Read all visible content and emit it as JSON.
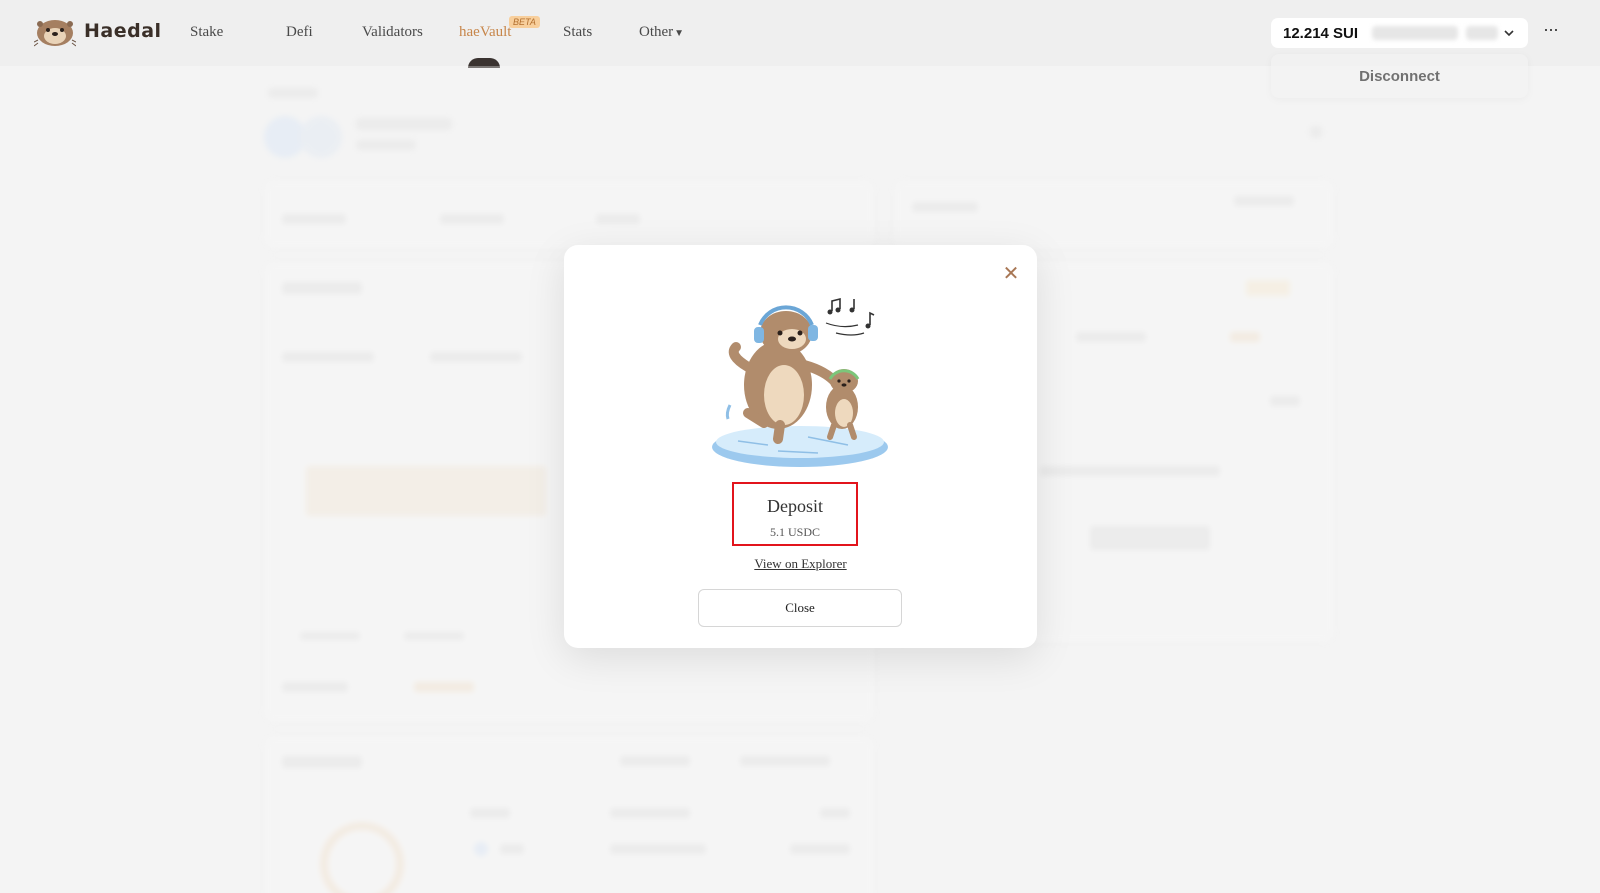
{
  "brand": {
    "name": "Haedal"
  },
  "nav": {
    "items": [
      {
        "label": "Stake"
      },
      {
        "label": "Defi"
      },
      {
        "label": "Validators"
      },
      {
        "label": "haeVault",
        "badge": "BETA"
      },
      {
        "label": "Stats"
      },
      {
        "label": "Other"
      }
    ],
    "active": "haeVault"
  },
  "wallet": {
    "balance": "12.214 SUI",
    "menu": {
      "disconnect_label": "Disconnect"
    }
  },
  "modal": {
    "title": "Deposit",
    "amount": "5.1 USDC",
    "explorer_link": "View on Explorer",
    "close_label": "Close"
  },
  "colors": {
    "accent": "#c7864a",
    "highlight_border": "#e2141c",
    "background": "#f3f3f3"
  }
}
